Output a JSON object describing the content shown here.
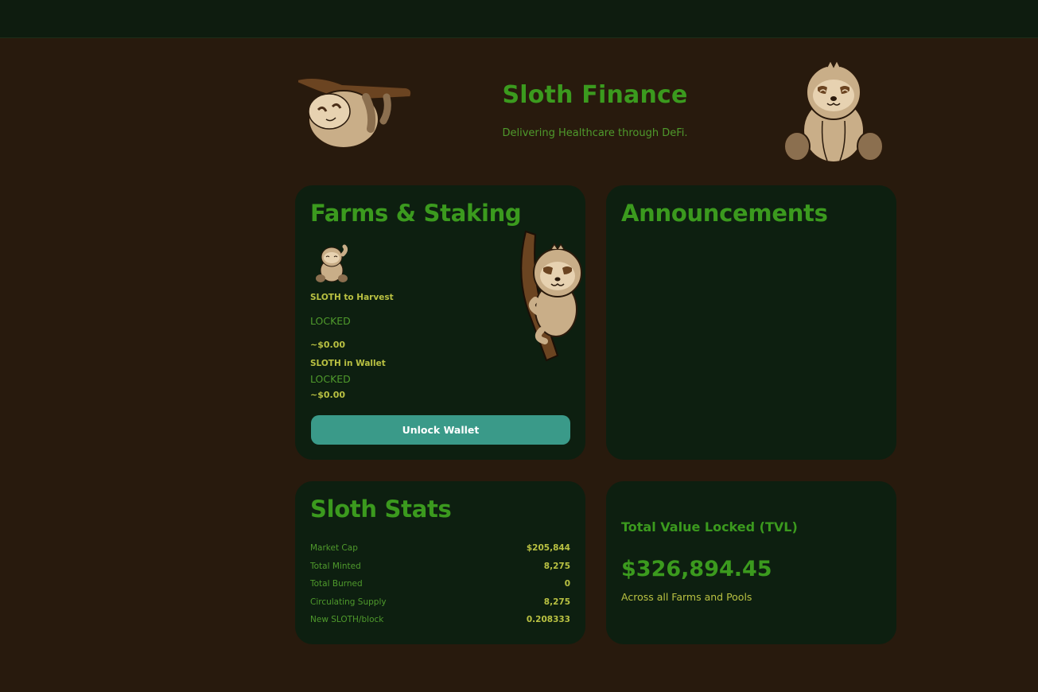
{
  "header": {
    "title": "Sloth Finance",
    "tagline": "Delivering Healthcare through DeFi."
  },
  "farms": {
    "title": "Farms & Staking",
    "harvest_label": "SLOTH to Harvest",
    "harvest_value": "LOCKED",
    "harvest_usd": "~$0.00",
    "wallet_label": "SLOTH in Wallet",
    "wallet_value": "LOCKED",
    "wallet_usd": "~$0.00",
    "unlock_button": "Unlock Wallet"
  },
  "announcements": {
    "title": "Announcements"
  },
  "stats": {
    "title": "Sloth Stats",
    "rows": [
      {
        "label": "Market Cap",
        "value": "$205,844"
      },
      {
        "label": "Total Minted",
        "value": "8,275"
      },
      {
        "label": "Total Burned",
        "value": "0"
      },
      {
        "label": "Circulating Supply",
        "value": "8,275"
      },
      {
        "label": "New SLOTH/block",
        "value": "0.208333"
      }
    ]
  },
  "tvl": {
    "title": "Total Value Locked (TVL)",
    "value": "$326,894.45",
    "subtitle": "Across all Farms and Pools"
  },
  "colors": {
    "page_bg": "#281a0d",
    "card_bg": "#0d1f10",
    "topbar_bg": "#0e1c0f",
    "heading_green": "#3b9a1e",
    "text_green": "#4f9a2c",
    "accent_yellow": "#b9c142",
    "button_teal": "#3a9a89"
  },
  "icons": {
    "hanging_sloth": "sloth-hanging-icon",
    "sitting_sloth": "sloth-sitting-icon",
    "small_sloth": "sloth-waving-icon",
    "branch_sloth": "sloth-branch-icon"
  }
}
